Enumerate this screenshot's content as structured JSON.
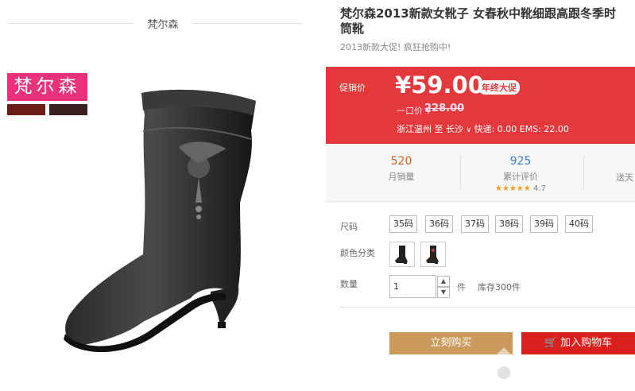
{
  "left": {
    "brand_header": "梵尔森",
    "logo_text": "梵尔森"
  },
  "product": {
    "title": "梵尔森2013新款女靴子 女春秋中靴细跟高跟冬季时",
    "title_line2": "筒靴",
    "subtitle": "2013新款大促! 疯狂抢购中!"
  },
  "price": {
    "label": "促销价",
    "value": "¥59.00",
    "tag": "年终大促",
    "original_label": "一口价 ¥",
    "original_value": "228.00",
    "ship_from": "浙江温州",
    "ship_to_word": "至",
    "ship_to": "长沙",
    "shipping": "快递: 0.00 EMS: 22.00"
  },
  "stats": {
    "monthly_sales_value": "520",
    "monthly_sales_label": "月销量",
    "reviews_value": "925",
    "reviews_label": "累计评价",
    "rating_stars": "★★★★★",
    "rating_value": "4.7",
    "third_label": "送天"
  },
  "options": {
    "size_label": "尺码",
    "sizes": [
      "35码",
      "36码",
      "37码",
      "38码",
      "39码",
      "40码"
    ],
    "color_label": "颜色分类",
    "qty_label": "数量",
    "qty_value": "1",
    "qty_unit": "件",
    "stock": "库存300件"
  },
  "actions": {
    "buy_now": "立刻购买",
    "add_to_cart": "加入购物车"
  },
  "colors": {
    "accent_red": "#e4393c",
    "buy_gold": "#c99a5c",
    "cart_red": "#d8211d",
    "logo_pink": "#e8327b"
  }
}
